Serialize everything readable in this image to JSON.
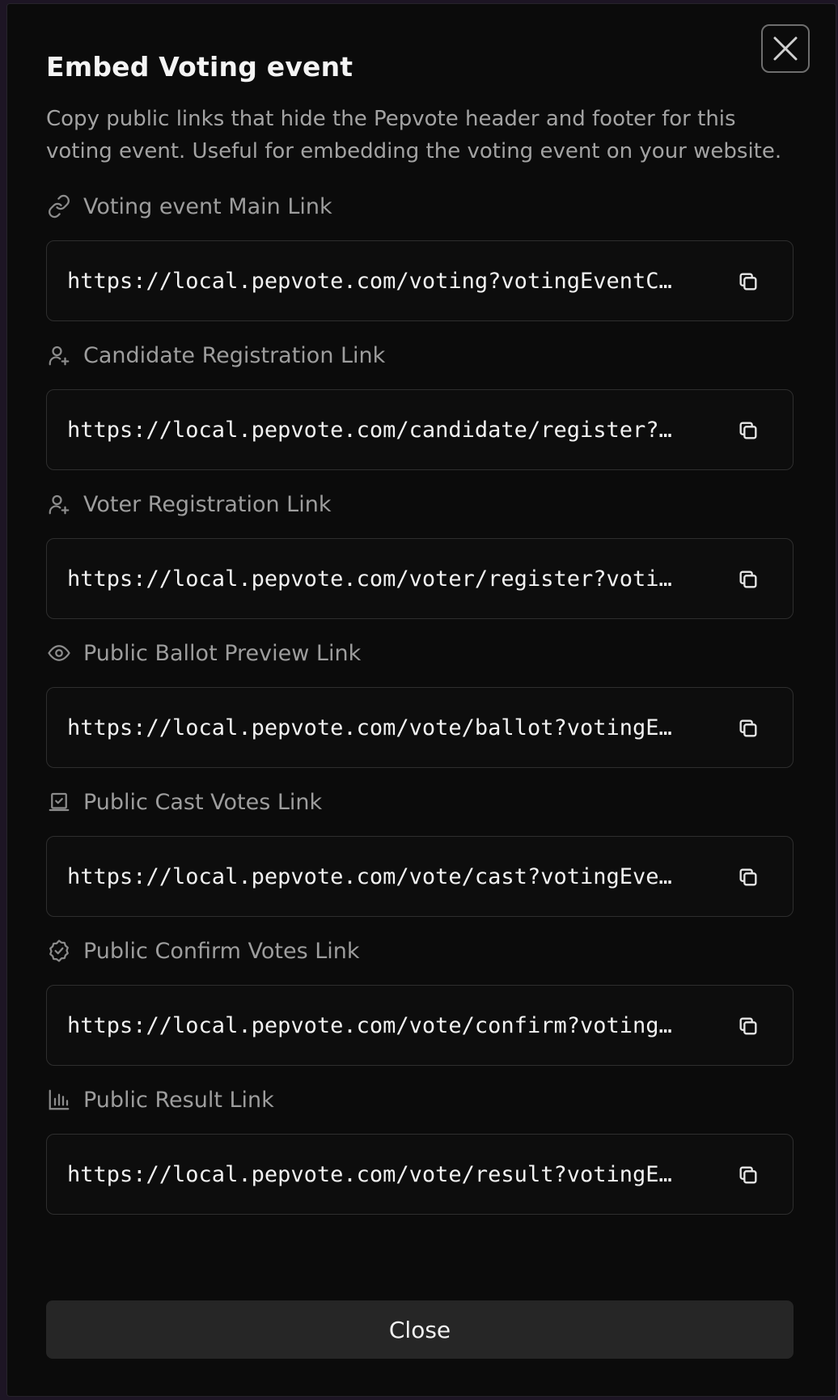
{
  "dialog": {
    "title": "Embed Voting event",
    "description": "Copy public links that hide the Pepvote header and footer for this voting event. Useful for embedding the voting event on your website.",
    "close_button_label": "Close"
  },
  "links": [
    {
      "label": "Voting event Main Link",
      "icon": "link-icon",
      "url": "https://local.pepvote.com/voting?votingEventC…"
    },
    {
      "label": "Candidate Registration Link",
      "icon": "user-plus-icon",
      "url": "https://local.pepvote.com/candidate/register?…"
    },
    {
      "label": "Voter Registration Link",
      "icon": "user-plus-icon",
      "url": "https://local.pepvote.com/voter/register?voti…"
    },
    {
      "label": "Public Ballot Preview Link",
      "icon": "eye-icon",
      "url": "https://local.pepvote.com/vote/ballot?votingE…"
    },
    {
      "label": "Public Cast Votes Link",
      "icon": "ballot-box-icon",
      "url": "https://local.pepvote.com/vote/cast?votingEve…"
    },
    {
      "label": "Public Confirm Votes Link",
      "icon": "badge-check-icon",
      "url": "https://local.pepvote.com/vote/confirm?voting…"
    },
    {
      "label": "Public Result Link",
      "icon": "bar-chart-icon",
      "url": "https://local.pepvote.com/vote/result?votingE…"
    }
  ],
  "colors": {
    "background": "#0b0b0b",
    "text_primary": "#f2f2f2",
    "text_muted": "#9d9d9d",
    "border": "#2e2e2e",
    "button_bg": "#262626"
  }
}
